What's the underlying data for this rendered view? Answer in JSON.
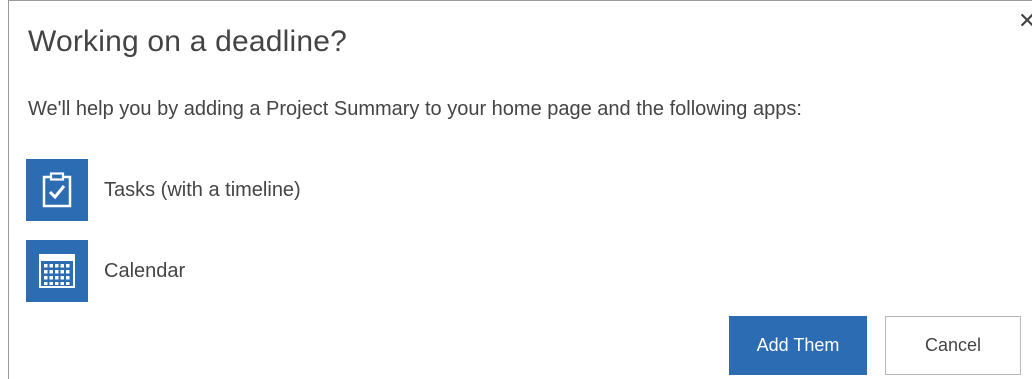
{
  "dialog": {
    "title": "Working on a deadline?",
    "close_icon": "close-icon",
    "description": "We'll help you by adding a Project Summary to your home page and the following apps:",
    "apps": [
      {
        "label": "Tasks (with a timeline)",
        "icon": "clipboard-check-icon"
      },
      {
        "label": "Calendar",
        "icon": "calendar-icon"
      }
    ],
    "buttons": {
      "add_label": "Add Them",
      "cancel_label": "Cancel"
    },
    "colors": {
      "accent": "#2b6cb3",
      "text": "#444444",
      "border": "#9a9a9a"
    }
  }
}
